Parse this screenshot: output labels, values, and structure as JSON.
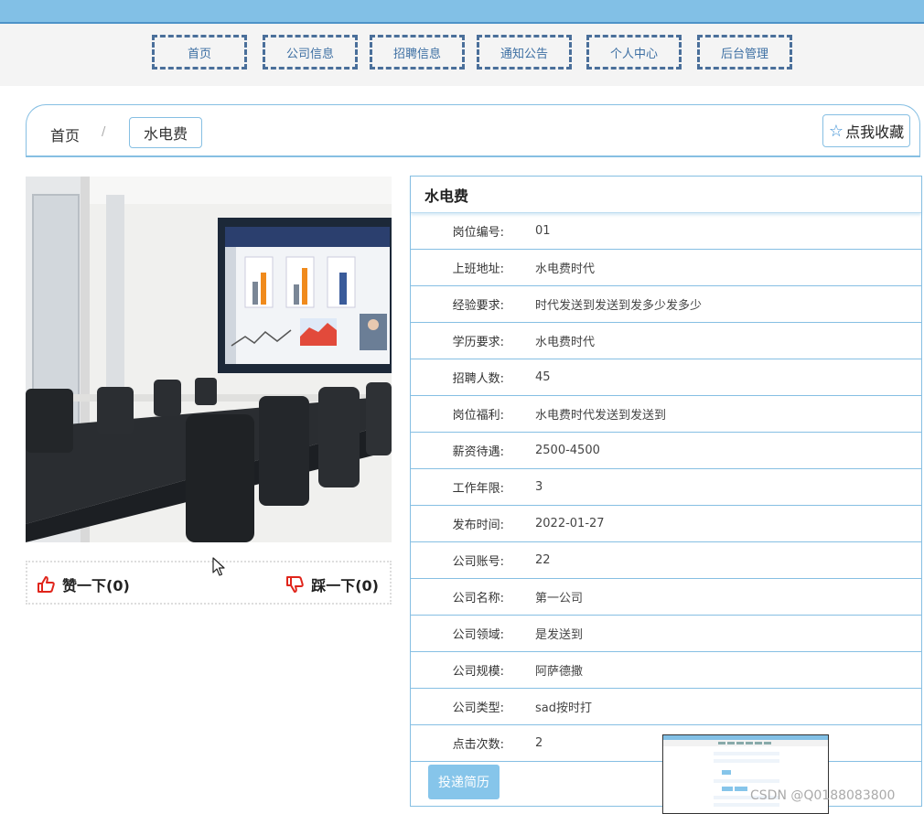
{
  "nav": {
    "items": [
      {
        "label": "首页"
      },
      {
        "label": "公司信息"
      },
      {
        "label": "招聘信息"
      },
      {
        "label": "通知公告"
      },
      {
        "label": "个人中心"
      },
      {
        "label": "后台管理"
      }
    ]
  },
  "breadcrumb": {
    "home": "首页",
    "separator": "/",
    "current": "水电费"
  },
  "favorite": {
    "label": "点我收藏",
    "icon": "star-outline-icon"
  },
  "votes": {
    "up_label": "赞一下(0)",
    "down_label": "踩一下(0)",
    "up_icon": "thumbs-up-icon",
    "down_icon": "thumbs-down-icon",
    "icon_color": "#e0251b"
  },
  "detail": {
    "title": "水电费",
    "fields": [
      {
        "key": "岗位编号:",
        "value": "01"
      },
      {
        "key": "上班地址:",
        "value": "水电费时代"
      },
      {
        "key": "经验要求:",
        "value": "时代发送到发送到发多少发多少"
      },
      {
        "key": "学历要求:",
        "value": "水电费时代"
      },
      {
        "key": "招聘人数:",
        "value": "45"
      },
      {
        "key": "岗位福利:",
        "value": "水电费时代发送到发送到"
      },
      {
        "key": "薪资待遇:",
        "value": "2500-4500"
      },
      {
        "key": "工作年限:",
        "value": "3"
      },
      {
        "key": "发布时间:",
        "value": "2022-01-27"
      },
      {
        "key": "公司账号:",
        "value": "22"
      },
      {
        "key": "公司名称:",
        "value": "第一公司"
      },
      {
        "key": "公司领域:",
        "value": "是发送到"
      },
      {
        "key": "公司规模:",
        "value": "阿萨德撒"
      },
      {
        "key": "公司类型:",
        "value": "sad按时打"
      },
      {
        "key": "点击次数:",
        "value": "2"
      }
    ],
    "apply_label": "投递简历"
  },
  "watermark": "CSDN @Q0188083800",
  "colors": {
    "accent": "#86c5ea",
    "nav_border": "#4a6f9a",
    "top_bar": "#82c0e6"
  }
}
